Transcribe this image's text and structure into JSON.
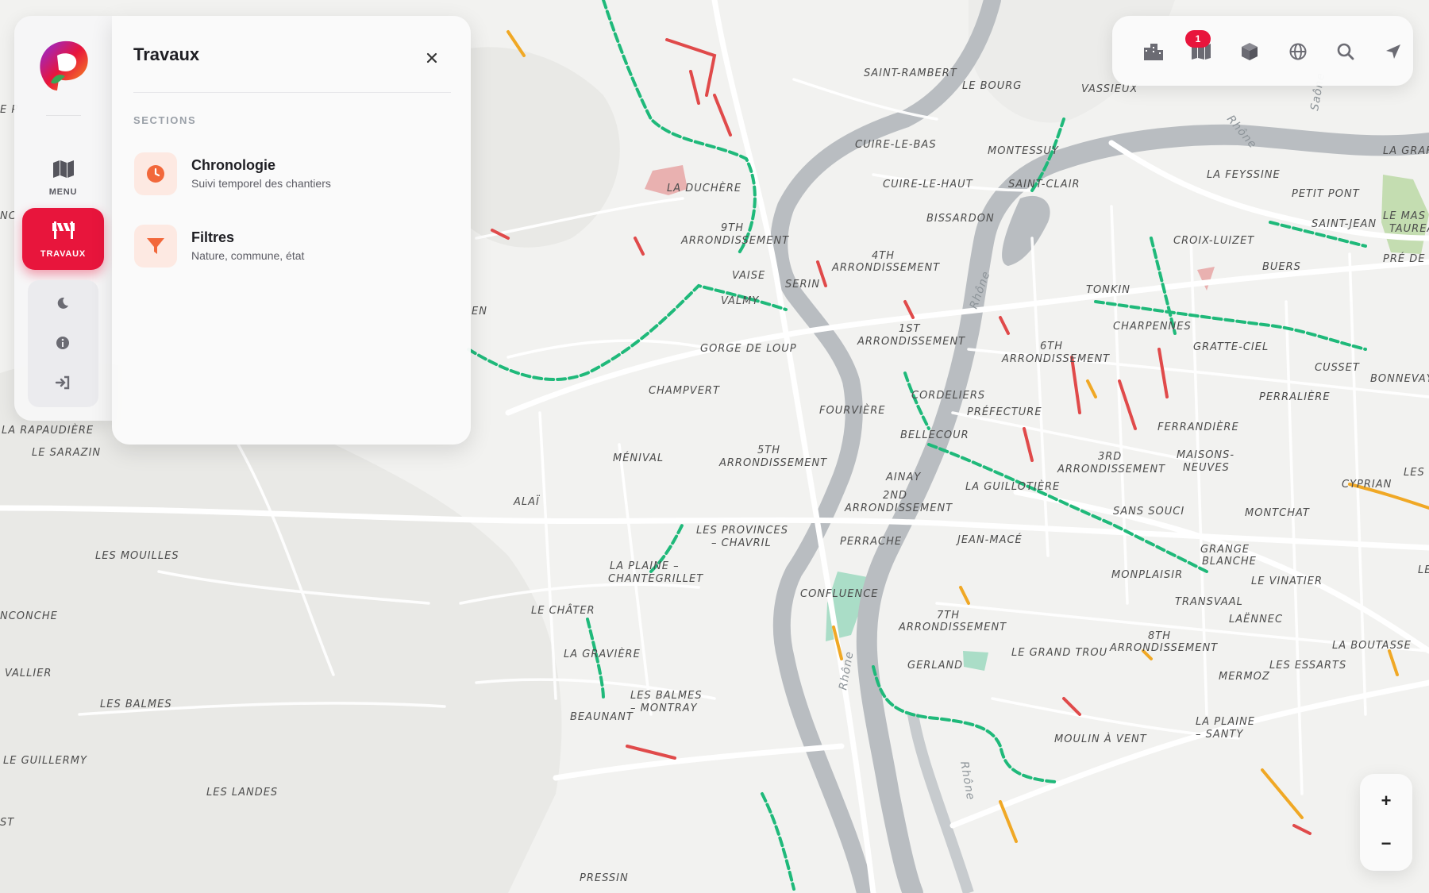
{
  "rail": {
    "menu_label": "MENU",
    "travaux_label": "TRAVAUX",
    "logo_icon": "app-logo",
    "tool_icons": [
      "moon-icon",
      "info-icon",
      "sign-in-icon"
    ]
  },
  "panel": {
    "title": "Travaux",
    "section_label": "SECTIONS",
    "items": [
      {
        "title": "Chronologie",
        "subtitle": "Suivi temporel des chantiers",
        "icon": "clock-icon"
      },
      {
        "title": "Filtres",
        "subtitle": "Nature, commune, état",
        "icon": "filter-icon"
      }
    ]
  },
  "toolbar": {
    "icons": [
      "buildings-icon",
      "map-layers-icon",
      "cube-icon",
      "globe-icon",
      "search-icon",
      "location-arrow-icon"
    ],
    "badge_count": "1"
  },
  "zoom": {
    "in_label": "+",
    "out_label": "−"
  },
  "colors": {
    "accent": "#e8153c",
    "icon_orange": "#f2683b",
    "works_green": "#1fb97a",
    "works_red": "#e04a4a",
    "works_orange": "#f0a825",
    "river": "#b7bbbf",
    "land": "#f2f2f0"
  },
  "map": {
    "labels": [
      "SAINT-RAMBERT",
      "LE BOURG",
      "VASSIEUX",
      "CUIRE-LE-BAS",
      "MONTESSUY",
      "LA GRAF",
      "LA DUCHÈRE",
      "CUIRE-LE-HAUT",
      "SAINT-CLAIR",
      "LA FEYSSINE",
      "PETIT PONT",
      "9TH",
      "ARRONDISSEMENT",
      "BISSARDON",
      "SAINT-JEAN",
      "LE MAS DU",
      "TAUREAU",
      "4TH",
      "ARRONDISSEMENT",
      "CROIX-LUIZET",
      "BUERS",
      "PRÉ DE L",
      "VAISE",
      "SERIN",
      "VALMY",
      "TONKIN",
      "GORGE DE LOUP",
      "1ST",
      "ARRONDISSEMENT",
      "CHARPENNES",
      "6TH",
      "ARRONDISSEMENT",
      "GRATTE-CIEL",
      "CUSSET",
      "BONNEVAY",
      "CHAMPVERT",
      "CORDELIERS",
      "FOURVIÈRE",
      "PRÉFECTURE",
      "PERRALIÈRE",
      "BELLECOUR",
      "FERRANDIÈRE",
      "LA RAPAUDIÈRE",
      "LE SARAZIN",
      "MÉNIVAL",
      "5TH",
      "ARRONDISSEMENT",
      "3RD",
      "ARRONDISSEMENT",
      "MAISONS-",
      "NEUVES",
      "CYPRIAN",
      "LES BRO",
      "AINAY",
      "LA GUILLOTIÈRE",
      "ALAÏ",
      "2ND",
      "ARRONDISSEMENT",
      "SANS SOUCI",
      "MONTCHAT",
      "LES PROVINCES",
      "– CHAVRIL",
      "PERRACHE",
      "JEAN-MACÉ",
      "LES MOUILLES",
      "GRANGE",
      "BLANCHE",
      "LA PLAINE –",
      "CHANTEGRILLET",
      "MONPLAISIR",
      "LE VINATIER",
      "CONFLUENCE",
      "TRANSVAAL",
      "LE CHÂTER",
      "7TH",
      "ARRONDISSEMENT",
      "LAËNNEC",
      "NCONCHE",
      "8TH",
      "ARRONDISSEMENT",
      "LA BOUTASSE",
      "LA GRAVIÈRE",
      "GERLAND",
      "LE GRAND TROU",
      "MERMOZ",
      "LES ESSARTS",
      "VALLIER",
      "LES BALMES",
      "LES BALMES",
      "– MONTRAY",
      "BEAUNANT",
      "MOULIN À VENT",
      "LA PLAINE",
      "– SANTY",
      "LE GUILLERMY",
      "LES LANDES",
      "ST",
      "PRESSIN",
      "EN",
      "LE",
      "NC",
      "E P"
    ],
    "rivers": [
      "Rhône",
      "Rhône",
      "Rhône",
      "Rhône",
      "Saône"
    ]
  }
}
